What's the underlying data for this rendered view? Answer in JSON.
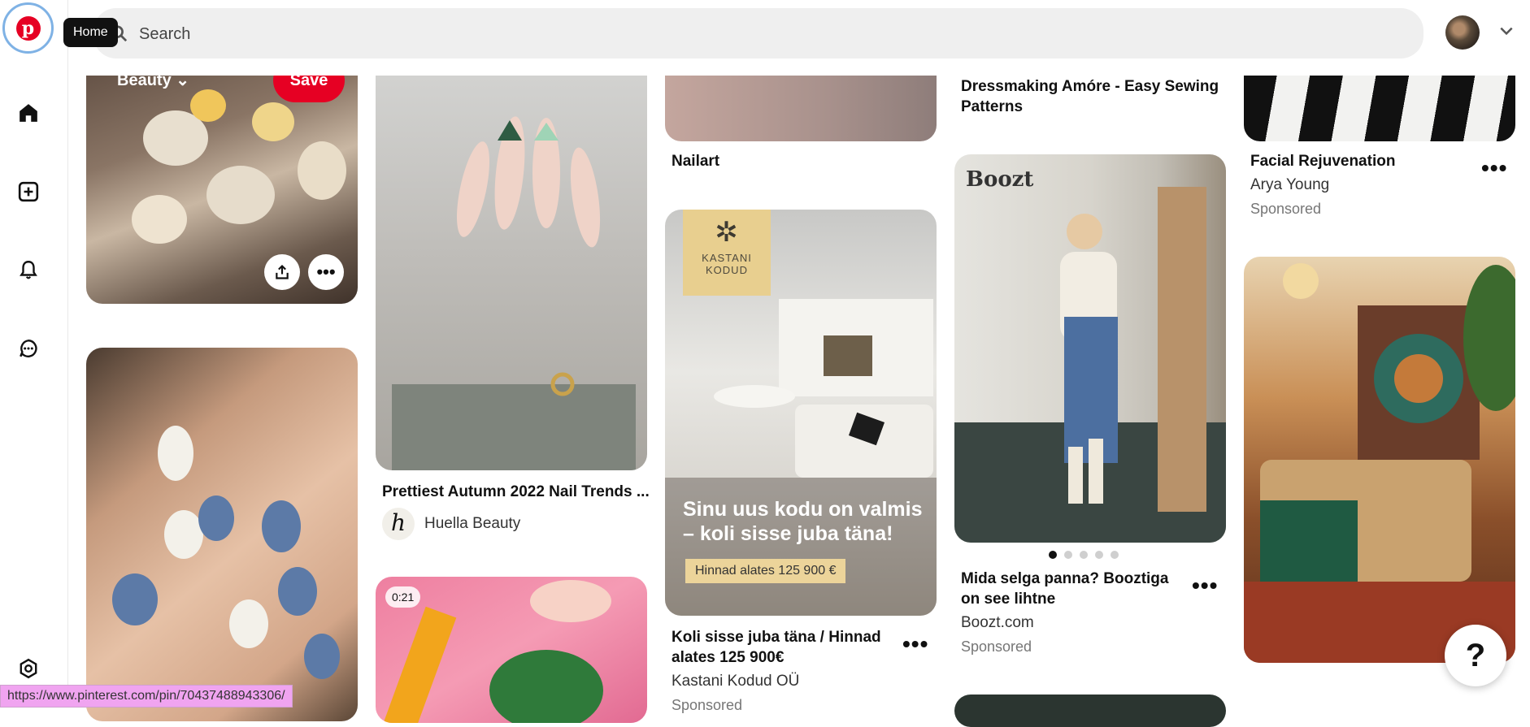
{
  "sidebar": {
    "logo_letter": "p",
    "tooltip": "Home",
    "icons": [
      "home-icon",
      "create-icon",
      "notifications-icon",
      "messages-icon",
      "settings-icon"
    ]
  },
  "header": {
    "search_placeholder": "Search"
  },
  "pins": {
    "p1": {
      "board": "Beauty",
      "save_label": "Save"
    },
    "p4": {
      "title": "Nailart"
    },
    "p5": {
      "title": "Koli sisse juba täna / Hinnad alates 125 900€",
      "source": "Kastani Kodud OÜ",
      "sponsored": "Sponsored",
      "ad_brand": "KASTANI KODUD",
      "ad_headline": "Sinu uus kodu on valmis – koli sisse juba täna!",
      "ad_price": "Hinnad alates 125 900 €"
    },
    "p6": {
      "title": "Prettiest Autumn 2022 Nail Trends ...",
      "source": "Huella Beauty"
    },
    "p7": {
      "duration": "0:21"
    },
    "p8": {
      "title": "Dressmaking Amóre - Easy Sewing Patterns"
    },
    "p9": {
      "brand_logo": "Boozt",
      "title": "Mida selga panna? Booztiga on see lihtne",
      "source": "Boozt.com",
      "sponsored": "Sponsored"
    },
    "p10": {
      "title": "Facial Rejuvenation",
      "source": "Arya Young",
      "sponsored": "Sponsored"
    }
  },
  "help_label": "?",
  "status_url": "https://www.pinterest.com/pin/70437488943306/",
  "colors": {
    "brand_red": "#e60023",
    "focus_ring": "#7fb2e5"
  }
}
